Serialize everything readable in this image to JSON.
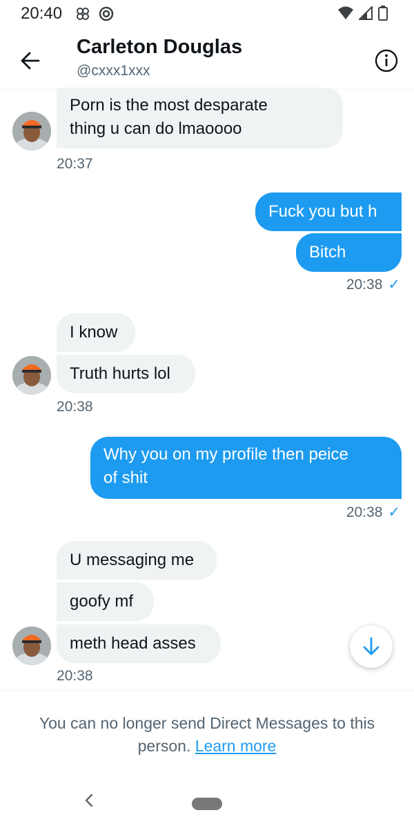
{
  "status_bar": {
    "time": "20:40"
  },
  "header": {
    "name": "Carleton Douglas",
    "handle": "@cxxx1xxx"
  },
  "messages": {
    "m1": {
      "text_line1": "Porn is the most desparate",
      "text_line2": "thing u can do lmaoooo",
      "time": "20:37"
    },
    "m2": {
      "text": "Fuck you but h"
    },
    "m3": {
      "text": "Bitch",
      "time": "20:38"
    },
    "m4": {
      "text": "I know"
    },
    "m5": {
      "text": "Truth hurts lol",
      "time": "20:38"
    },
    "m6": {
      "text_line1": "Why you on my profile then peice",
      "text_line2": "of shit",
      "time": "20:38"
    },
    "m7": {
      "text": "U messaging me"
    },
    "m8": {
      "text": "goofy mf"
    },
    "m9": {
      "text": "meth head asses",
      "time": "20:38"
    }
  },
  "notice": {
    "text": "You can no longer send Direct Messages to this person.",
    "link": "Learn more"
  },
  "icons": {
    "back": "arrow-left-icon",
    "info": "info-icon",
    "scroll_down": "arrow-down-icon",
    "read_receipt": "checkmark-icon"
  },
  "colors": {
    "accent": "#1d9bf0",
    "incoming_bubble": "#eff3f4",
    "secondary_text": "#536471"
  }
}
